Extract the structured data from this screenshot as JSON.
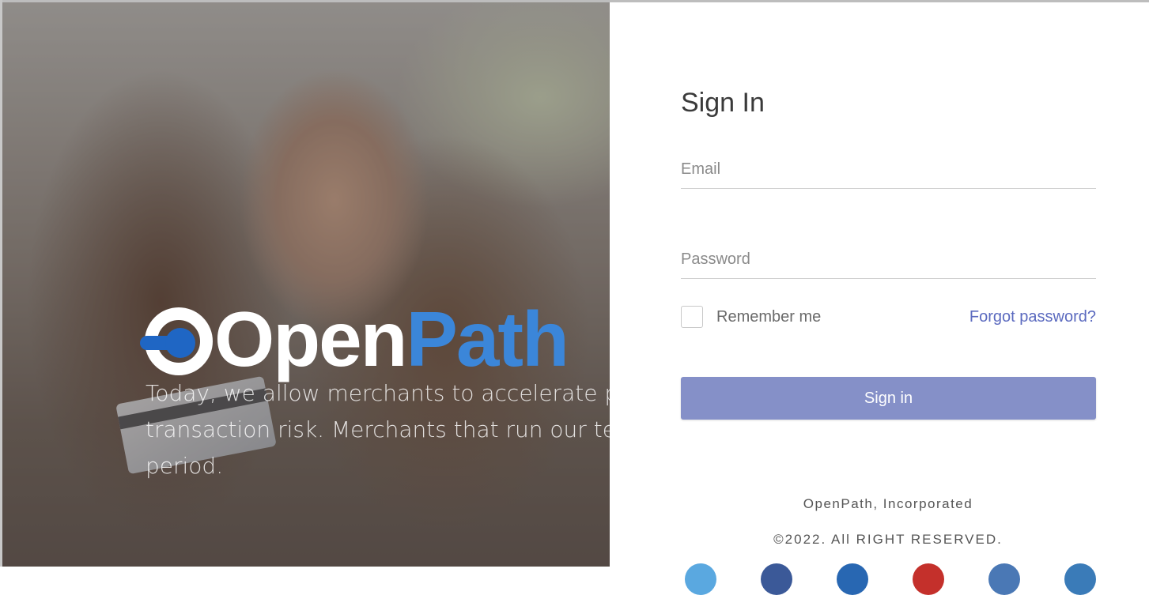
{
  "hero": {
    "logo_open": "Open",
    "logo_path": "Path",
    "tagline_lines": [
      "Today, we allow merchants to accelerate payı",
      "transaction risk. Merchants that run our techı",
      "period."
    ]
  },
  "signin": {
    "title": "Sign In",
    "email_placeholder": "Email",
    "password_placeholder": "Password",
    "remember_label": "Remember me",
    "forgot_label": "Forgot password?",
    "button_label": "Sign in"
  },
  "footer": {
    "company": "OpenPath, Incorporated",
    "copyright": "©2022. All RIGHT RESERVED."
  },
  "social_icons": [
    {
      "name": "twitter-icon",
      "color": "#5aa8e0"
    },
    {
      "name": "facebook-icon",
      "color": "#3b5998"
    },
    {
      "name": "linkedin-icon",
      "color": "#2867b2"
    },
    {
      "name": "youtube-icon",
      "color": "#c4302b"
    },
    {
      "name": "instagram-icon",
      "color": "#4a78b5"
    },
    {
      "name": "skype-icon",
      "color": "#3a7bb8"
    }
  ],
  "colors": {
    "accent": "#5b6abf",
    "button": "#8590c8",
    "logo_blue": "#3b86d9"
  }
}
